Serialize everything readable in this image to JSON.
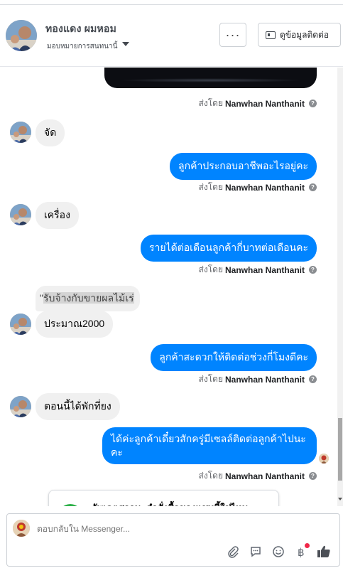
{
  "header": {
    "name": "ทองแดง ผมหอม",
    "assign_label": "มอบหมายการสนทนานี้",
    "more_label": "···",
    "contact_button_label": "ดูข้อมูลติดต่อ"
  },
  "thread": {
    "sender_prefix": "ส่งโดย",
    "sender_name": "Nanwhan Nanthanit",
    "messages": [
      {
        "dir": "in",
        "text": "จัด"
      },
      {
        "dir": "out",
        "text": "ลูกค้าประกอบอาชีพอะไรอยู่คะ"
      },
      {
        "dir": "in",
        "text": "เครื่อง"
      },
      {
        "dir": "out",
        "text": "รายได้ต่อเดือนลูกค้ากี่บาทต่อเดือนคะ"
      },
      {
        "dir": "in",
        "text": "ประมาณ2000"
      },
      {
        "dir": "out",
        "text": "ลูกค้าสะดวกให้ติดต่อช่วงกี่โมงดีคะ"
      },
      {
        "dir": "in",
        "text": "ตอนนี้ได้พักที่ยง"
      },
      {
        "dir": "out",
        "text": "ได้ค่ะลูกค้าเดี๋ยวสักครู่มีเซลล์ติดต่อลูกค้าไปนะคะ"
      }
    ],
    "quote_prefix": "\"",
    "quote_text": "รับจ้างกับขายผลไม้เร่",
    "order_card_title": "อัพเดตสถานะคำสั่งซื้อของแชทนี้ใช่ไหม"
  },
  "composer": {
    "placeholder": "ตอบกลับใน Messenger..."
  }
}
